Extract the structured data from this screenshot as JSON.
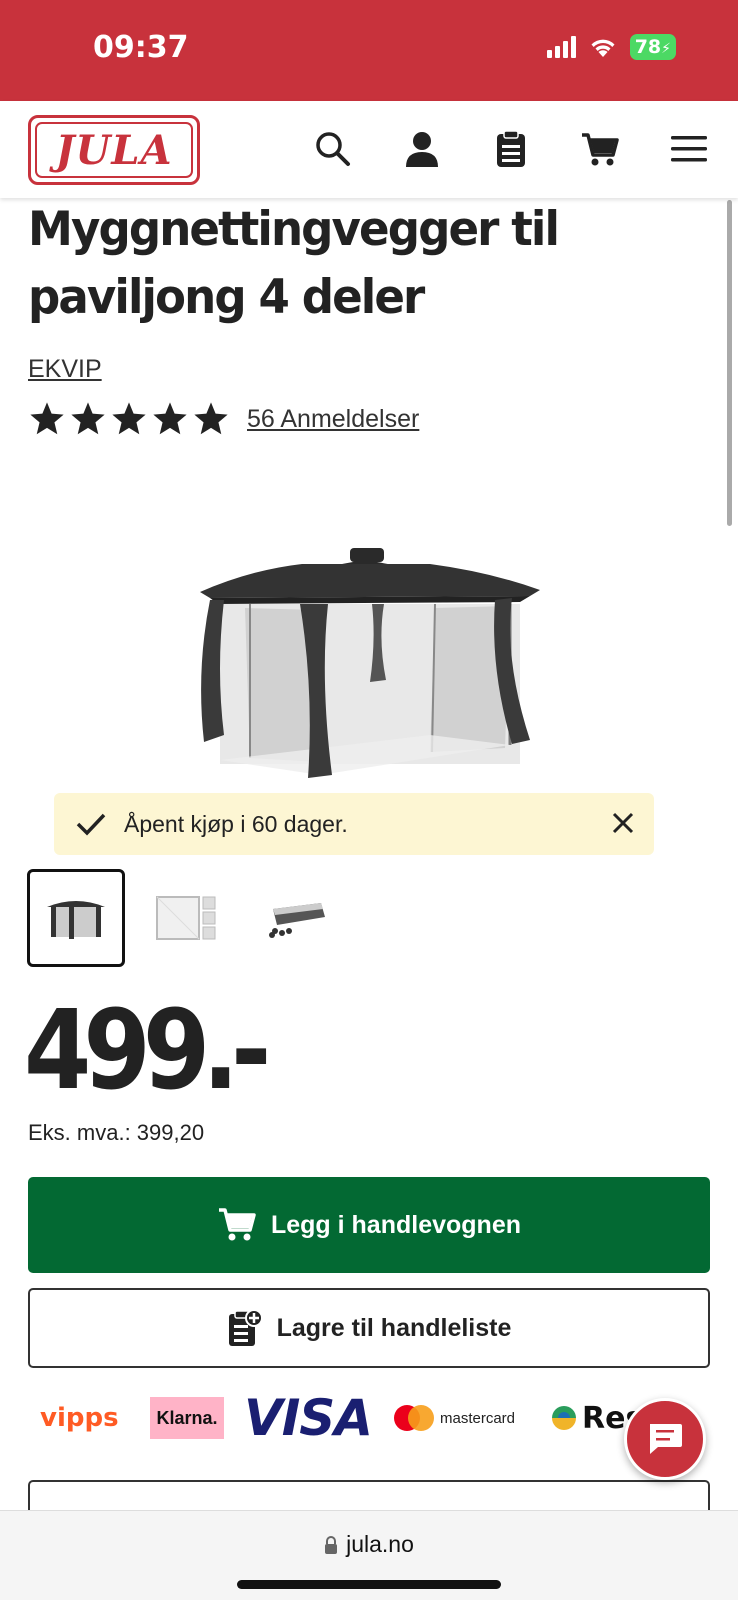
{
  "status_bar": {
    "time": "09:37",
    "battery": "78",
    "icons": [
      "signal-icon",
      "wifi-icon",
      "battery-icon"
    ],
    "color": "#c8323c"
  },
  "header": {
    "logo_text": "JULA",
    "icons": [
      "search-icon",
      "account-icon",
      "clipboard-icon",
      "cart-icon",
      "menu-icon"
    ]
  },
  "product": {
    "title": "Myggnettingvegger til paviljong 4 deler",
    "brand": "EKVIP",
    "rating_stars": 5,
    "reviews": "56 Anmeldelser",
    "notice": "Åpent kjøp i 60 dager.",
    "price": "499.-",
    "vat": "Eks. mva.: 399,20"
  },
  "actions": {
    "add_to_cart": "Legg i handlevognen",
    "save_to_list": "Lagre til handleliste"
  },
  "payments": {
    "vipps": "vipps",
    "klarna": "Klarna.",
    "visa": "VISA",
    "mastercard": "mastercard",
    "resurs": "Res"
  },
  "browser": {
    "url": "jula.no"
  },
  "colors": {
    "brand_red": "#c8323c",
    "cart_green": "#036933",
    "notice_bg": "#fdf6d3"
  }
}
